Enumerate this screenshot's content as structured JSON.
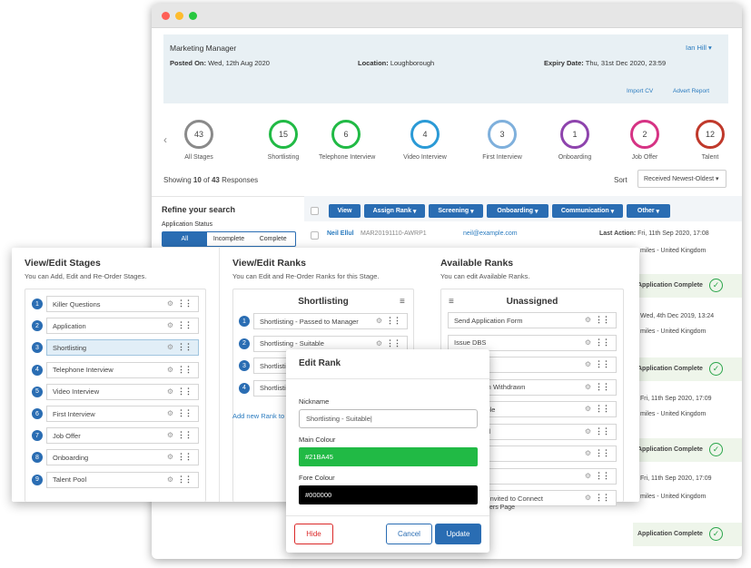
{
  "job": {
    "title": "Marketing Manager",
    "user": "Ian Hill",
    "posted_label": "Posted On:",
    "posted": "Wed, 12th Aug 2020",
    "location_label": "Location:",
    "location": "Loughborough",
    "expiry_label": "Expiry Date:",
    "expiry": "Thu, 31st Dec 2020, 23:59",
    "import_cv": "Import CV",
    "advert_report": "Advert Report"
  },
  "stages": [
    {
      "count": "43",
      "label": "All Stages",
      "color": "#8a8a8a"
    },
    {
      "count": "15",
      "label": "Shortlisting",
      "color": "#21BA45"
    },
    {
      "count": "6",
      "label": "Telephone Interview",
      "color": "#21BA45"
    },
    {
      "count": "4",
      "label": "Video Interview",
      "color": "#2b9ad6"
    },
    {
      "count": "3",
      "label": "First Interview",
      "color": "#7fb0dc"
    },
    {
      "count": "1",
      "label": "Onboarding",
      "color": "#8e44ad"
    },
    {
      "count": "2",
      "label": "Job Offer",
      "color": "#d63384"
    },
    {
      "count": "12",
      "label": "Talent",
      "color": "#c0392b"
    }
  ],
  "showing": {
    "prefix": "Showing ",
    "shown": "10",
    "of": " of ",
    "total": "43",
    "suffix": " Responses"
  },
  "sort": {
    "label": "Sort",
    "value": "Received Newest-Oldest"
  },
  "refine": {
    "title": "Refine your search",
    "status_label": "Application Status",
    "tabs": [
      "All",
      "Incomplete",
      "Complete"
    ]
  },
  "toolbar": [
    "View",
    "Assign Rank",
    "Screening",
    "Onboarding",
    "Communication",
    "Other"
  ],
  "rows": [
    {
      "name": "Neil Ellul",
      "ref": "MAR20191110-AWRP1",
      "email": "neil@example.com",
      "action_label": "Last Action:",
      "action": "Fri, 11th Sep 2020, 17:08",
      "distance": "miles - United Kingdom",
      "status": "Application Complete"
    },
    {
      "action": "Wed, 4th Dec 2019, 13:24",
      "distance": "miles - United Kingdom",
      "status": "Application Complete"
    },
    {
      "action": "Fri, 11th Sep 2020, 17:09",
      "distance": "miles - United Kingdom",
      "status": "Application Complete"
    },
    {
      "action": "Fri, 11th Sep 2020, 17:09",
      "distance": "miles - United Kingdom",
      "status": "Application Complete"
    }
  ],
  "stages_panel": {
    "title": "View/Edit Stages",
    "subtitle": "You can Add, Edit and Re-Order Stages.",
    "items": [
      "Killer Questions",
      "Application",
      "Shortlisting",
      "Telephone Interview",
      "Video Interview",
      "First Interview",
      "Job Offer",
      "Onboarding",
      "Talent Pool"
    ],
    "selected": 2
  },
  "ranks_panel": {
    "title": "View/Edit Ranks",
    "subtitle": "You can Edit and Re-Order Ranks for this Stage.",
    "column": "Shortlisting",
    "items": [
      "Shortlisting - Passed to Manager",
      "Shortlisting - Suitable",
      "Shortlisting - Unsuitable",
      "Shortlisting - Pending"
    ],
    "add": "Add new Rank to"
  },
  "avail_panel": {
    "title": "Available Ranks",
    "subtitle": "You can edit Available Ranks.",
    "column": "Unassigned",
    "items": [
      "Send Application Form",
      "Issue DBS",
      "",
      "- Application Withdrawn",
      "- Not Suitable",
      "- UnRanked",
      "Accepted",
      "il sent",
      "nt Centre - Invited to Connect"
    ],
    "extra": "ers Page"
  },
  "modal": {
    "title": "Edit Rank",
    "nickname_label": "Nickname",
    "nickname": "Shortlisting - Suitable",
    "main_label": "Main Colour",
    "main": "#21BA45",
    "fore_label": "Fore Colour",
    "fore": "#000000",
    "hide": "Hide",
    "cancel": "Cancel",
    "update": "Update"
  },
  "colors": {
    "primary": "#2a6db3",
    "green": "#21BA45",
    "red": "#db2828"
  }
}
